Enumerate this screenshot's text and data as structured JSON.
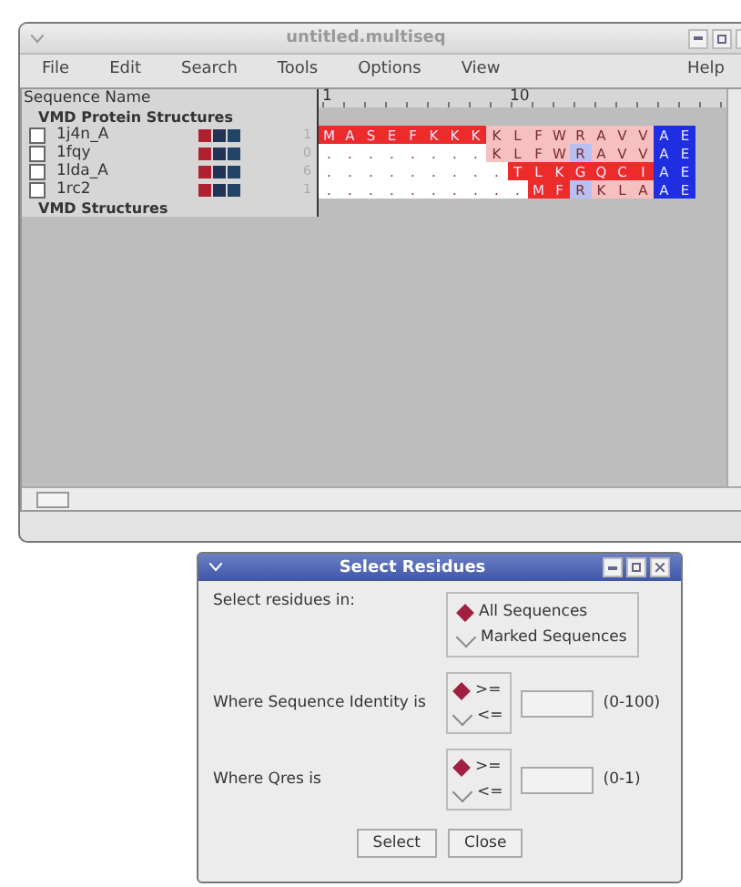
{
  "window": {
    "title": "untitled.multiseq"
  },
  "menu": [
    {
      "label": "File"
    },
    {
      "label": "Edit"
    },
    {
      "label": "Search"
    },
    {
      "label": "Tools"
    },
    {
      "label": "Options"
    },
    {
      "label": "View"
    },
    {
      "label": "Help"
    }
  ],
  "header": {
    "name_column": "Sequence Name",
    "ruler": [
      "1",
      "10"
    ]
  },
  "groups": [
    {
      "title": "VMD Protein Structures",
      "rows": [
        {
          "name": "1j4n_A",
          "checked": false,
          "start": "1",
          "cells": [
            {
              "r": "M",
              "color": "#ee2b2b"
            },
            {
              "r": "A",
              "color": "#ee2b2b"
            },
            {
              "r": "S",
              "color": "#ee2b2b"
            },
            {
              "r": "E",
              "color": "#ee2b2b"
            },
            {
              "r": "F",
              "color": "#ee2b2b"
            },
            {
              "r": "K",
              "color": "#ee2b2b"
            },
            {
              "r": "K",
              "color": "#ee2b2b"
            },
            {
              "r": "K",
              "color": "#ee2b2b"
            },
            {
              "r": "K",
              "color": "#f6c0c0"
            },
            {
              "r": "L",
              "color": "#f6c0c0"
            },
            {
              "r": "F",
              "color": "#f6c0c0"
            },
            {
              "r": "W",
              "color": "#f6c0c0"
            },
            {
              "r": "R",
              "color": "#f6c0c0"
            },
            {
              "r": "A",
              "color": "#f6c0c0"
            },
            {
              "r": "V",
              "color": "#f6c0c0"
            },
            {
              "r": "V",
              "color": "#f6c0c0"
            },
            {
              "r": "A",
              "color": "#1f2ee0"
            },
            {
              "r": "E",
              "color": "#1f2ee0"
            }
          ]
        },
        {
          "name": "1fqy",
          "checked": false,
          "start": "0",
          "cells": [
            {
              "r": ".",
              "color": "#ffffff"
            },
            {
              "r": ".",
              "color": "#ffffff"
            },
            {
              "r": ".",
              "color": "#ffffff"
            },
            {
              "r": ".",
              "color": "#ffffff"
            },
            {
              "r": ".",
              "color": "#ffffff"
            },
            {
              "r": ".",
              "color": "#ffffff"
            },
            {
              "r": ".",
              "color": "#ffffff"
            },
            {
              "r": ".",
              "color": "#ffffff"
            },
            {
              "r": "K",
              "color": "#f6c0c0"
            },
            {
              "r": "L",
              "color": "#f6c0c0"
            },
            {
              "r": "F",
              "color": "#f6c0c0"
            },
            {
              "r": "W",
              "color": "#f6c0c0"
            },
            {
              "r": "R",
              "color": "#b8c0f2"
            },
            {
              "r": "A",
              "color": "#f6c0c0"
            },
            {
              "r": "V",
              "color": "#f6c0c0"
            },
            {
              "r": "V",
              "color": "#f6c0c0"
            },
            {
              "r": "A",
              "color": "#1f2ee0"
            },
            {
              "r": "E",
              "color": "#1f2ee0"
            }
          ]
        },
        {
          "name": "1lda_A",
          "checked": false,
          "start": "6",
          "cells": [
            {
              "r": ".",
              "color": "#ffffff"
            },
            {
              "r": ".",
              "color": "#ffffff"
            },
            {
              "r": ".",
              "color": "#ffffff"
            },
            {
              "r": ".",
              "color": "#ffffff"
            },
            {
              "r": ".",
              "color": "#ffffff"
            },
            {
              "r": ".",
              "color": "#ffffff"
            },
            {
              "r": ".",
              "color": "#ffffff"
            },
            {
              "r": ".",
              "color": "#ffffff"
            },
            {
              "r": ".",
              "color": "#ffffff"
            },
            {
              "r": "T",
              "color": "#ee2b2b"
            },
            {
              "r": "L",
              "color": "#ee2b2b"
            },
            {
              "r": "K",
              "color": "#ee2b2b"
            },
            {
              "r": "G",
              "color": "#ee2b2b"
            },
            {
              "r": "Q",
              "color": "#ee2b2b"
            },
            {
              "r": "C",
              "color": "#ee2b2b"
            },
            {
              "r": "I",
              "color": "#ee2b2b"
            },
            {
              "r": "A",
              "color": "#1f2ee0"
            },
            {
              "r": "E",
              "color": "#1f2ee0"
            }
          ]
        },
        {
          "name": "1rc2",
          "checked": false,
          "start": "1",
          "cells": [
            {
              "r": ".",
              "color": "#ffffff"
            },
            {
              "r": ".",
              "color": "#ffffff"
            },
            {
              "r": ".",
              "color": "#ffffff"
            },
            {
              "r": ".",
              "color": "#ffffff"
            },
            {
              "r": ".",
              "color": "#ffffff"
            },
            {
              "r": ".",
              "color": "#ffffff"
            },
            {
              "r": ".",
              "color": "#ffffff"
            },
            {
              "r": ".",
              "color": "#ffffff"
            },
            {
              "r": ".",
              "color": "#ffffff"
            },
            {
              "r": ".",
              "color": "#ffffff"
            },
            {
              "r": "M",
              "color": "#ee2b2b"
            },
            {
              "r": "F",
              "color": "#ee2b2b"
            },
            {
              "r": "R",
              "color": "#b8c0f2"
            },
            {
              "r": "K",
              "color": "#f6c0c0"
            },
            {
              "r": "L",
              "color": "#f6c0c0"
            },
            {
              "r": "A",
              "color": "#f6c0c0"
            },
            {
              "r": "A",
              "color": "#1f2ee0"
            },
            {
              "r": "E",
              "color": "#1f2ee0"
            }
          ]
        }
      ]
    },
    {
      "title": "VMD Structures"
    }
  ],
  "dialog": {
    "title": "Select Residues",
    "scope": {
      "label": "Select residues in:",
      "options": [
        {
          "label": "All Sequences",
          "selected": true
        },
        {
          "label": "Marked Sequences",
          "selected": false
        }
      ]
    },
    "filters": [
      {
        "label": "Where Sequence Identity is",
        "options": [
          {
            "label": ">=",
            "selected": true
          },
          {
            "label": "<=",
            "selected": false
          }
        ],
        "range": "(0-100)"
      },
      {
        "label": "Where Qres is",
        "options": [
          {
            "label": ">=",
            "selected": true
          },
          {
            "label": "<=",
            "selected": false
          }
        ],
        "range": "(0-1)"
      }
    ],
    "buttons": [
      {
        "label": "Select"
      },
      {
        "label": "Close"
      }
    ]
  }
}
